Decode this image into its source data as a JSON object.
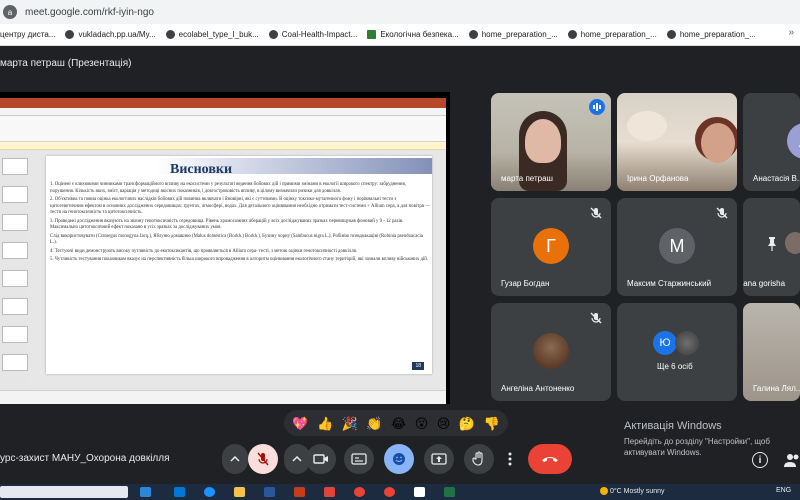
{
  "browser": {
    "site_icon_letter": "a",
    "url": "meet.google.com/rkf-iyin-ngo",
    "bookmarks": [
      "центру диста...",
      "vukladach.pp.ua/My...",
      "ecolabel_type_I_buk...",
      "Coal-Health-Impact...",
      "Екологічна безпека...",
      "home_preparation_...",
      "home_preparation_...",
      "home_preparation_..."
    ],
    "bookmarks_more": "»"
  },
  "presenter": {
    "label": "марта петраш (Презентація)"
  },
  "slide": {
    "title": "Висновки",
    "paragraphs": [
      "1. Оцінені є ключовими чинниками трансформаційного впливу на екосистеми у результаті ведення бойових дій і прямими змінами в екології широкого спектру: забруднення, порушення. Кількість яких, зміст, варіація у методиці якісних показників, і довгостроковість впливу, в цілому визначили ризики для довкілля.",
      "2. Об'єктивна та повна оцінка екологічних наслідків бойових дій повинна включати і ймовірні, які є суттєвими. В оцінку токсико-мутагенного фону і порівняльні тести з цитогенетичним ефектом в основних досліджених середовищах: ґрунтах, атмосфері, водах. Для детального оцінювання необхідно отримати тест-системи + Allium сера, а для повітря — тести на генотоксичність та цитотоксичність.",
      "3. Проведені дослідження вказують на значну генотоксичність середовища. Рівень хромосомних аберацій у всіх досліджуваних зразках перевищував фоновий у 9 - 12 разів. Максимально цитотоксичний ефект показано в усіх зразках за досліджуваних умов.",
      "Слід використовувати (Cratoegus monogyna Jacq.), Яблуню домашню (Malus domestica (Borkh.) Borkh.), Бузину чорну (Sambucus nigra L.), Робінію псевдоакацію (Robinia pseudoacacia L.).",
      "4. Тестуючі види демонструють високу чутливість до екотоксикантів, що проявляється в Allium cepa- тесті, з метою оцінки генотоксичності довкілля.",
      "5. Чутливість тестування показником вказує на перспективність більш широкого впровадження в алгоритм оцінювання екологічного стану територій, які зазнали впливу військових дій."
    ],
    "number": "18"
  },
  "participants": [
    {
      "name": "марта петраш",
      "video": true,
      "speaking": true
    },
    {
      "name": "Ірина Орфанова",
      "video": true
    },
    {
      "name": "Анастасія В...",
      "initial": "А",
      "color": "#9aa0d6"
    },
    {
      "name": "Гузар Богдан",
      "initial": "Г",
      "color": "#e8710a",
      "muted": true
    },
    {
      "name": "Максим Старжинський",
      "initial": "М",
      "color": "#5f6368",
      "muted": true
    },
    {
      "name": "diana gorisha",
      "muted": true
    },
    {
      "name": "Ангеліна Антоненко",
      "muted": true
    },
    {
      "name": "Ще 6 осіб",
      "initial": "Ю",
      "color": "#1a73e8"
    },
    {
      "name": "Галина Лял...",
      "video": true
    }
  ],
  "reactions": [
    "💖",
    "👍",
    "🎉",
    "👏",
    "😂",
    "😮",
    "😢",
    "🤔",
    "👎"
  ],
  "meeting": {
    "title": "урс-захист МАНУ_Охорона довкілля"
  },
  "activation": {
    "line1": "Активація Windows",
    "line2": "Перейдіть до розділу \"Настройки\", щоб активувати Windows."
  },
  "taskbar": {
    "weather": "0°C",
    "weather_desc": "Mostly sunny",
    "lang": "ENG"
  },
  "colors": {
    "meet_bg": "#202124",
    "tile_bg": "#3c4043",
    "end_call": "#ea4335",
    "mic_off": "#f9dedc",
    "accent": "#8ab4f8"
  }
}
